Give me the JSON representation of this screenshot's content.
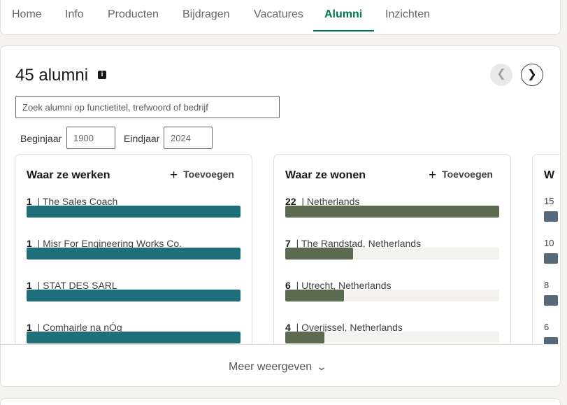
{
  "tabs": [
    "Home",
    "Info",
    "Producten",
    "Bijdragen",
    "Vacatures",
    "Alumni",
    "Inzichten"
  ],
  "active_tab": "Alumni",
  "title": "45 alumni",
  "info_icon": "i",
  "search": {
    "placeholder": "Zoek alumni op functietitel, trefwoord of bedrijf"
  },
  "year_filter": {
    "start_label": "Beginjaar",
    "start_value": "1900",
    "end_label": "Eindjaar",
    "end_value": "2024"
  },
  "columns": [
    {
      "title": "Waar ze werken",
      "add_label": "Toevoegen",
      "bar_color": "#1f6f7a",
      "items": [
        {
          "count": "1",
          "label": "The Sales Coach",
          "fraction": 1.0
        },
        {
          "count": "1",
          "label": "Misr For Engineering Works Co.",
          "fraction": 1.0
        },
        {
          "count": "1",
          "label": "STAT DES SARL",
          "fraction": 1.0
        },
        {
          "count": "1",
          "label": "Comhairle na nÓg",
          "fraction": 1.0
        }
      ]
    },
    {
      "title": "Waar ze wonen",
      "add_label": "Toevoegen",
      "bar_color": "#5a6b50",
      "items": [
        {
          "count": "22",
          "label": "Netherlands",
          "fraction": 1.0
        },
        {
          "count": "7",
          "label": "The Randstad, Netherlands",
          "fraction": 0.318
        },
        {
          "count": "6",
          "label": "Utrecht, Netherlands",
          "fraction": 0.273
        },
        {
          "count": "4",
          "label": "Overijssel, Netherlands",
          "fraction": 0.182
        }
      ]
    }
  ],
  "third_column": {
    "title_partial": "W",
    "counts": [
      "15",
      "10",
      "8",
      "6"
    ],
    "bar_color": "#56687a"
  },
  "show_more_label": "Meer weergeven",
  "icons": {
    "prev": "chevron-left-icon",
    "next": "chevron-right-icon",
    "add": "plus-icon",
    "more": "chevron-down-icon",
    "info": "info-icon"
  }
}
